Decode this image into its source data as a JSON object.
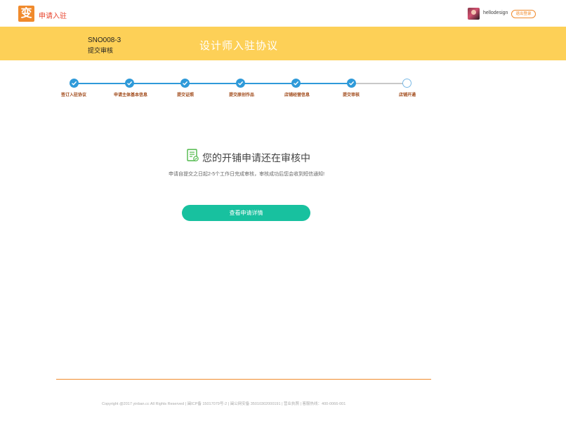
{
  "header": {
    "logo_char": "变",
    "brand": "申请入驻",
    "username": "hellodesign",
    "logout_label": "退出登录"
  },
  "banner": {
    "sno": "SNO008-3",
    "status": "提交审核",
    "title": "设计师入驻协议"
  },
  "steps": [
    {
      "label": "签订入驻协议",
      "done": true
    },
    {
      "label": "申请主体基本信息",
      "done": true
    },
    {
      "label": "提交证照",
      "done": true
    },
    {
      "label": "提交原创作品",
      "done": true
    },
    {
      "label": "店铺经营信息",
      "done": true
    },
    {
      "label": "提交审核",
      "done": true
    },
    {
      "label": "店铺开通",
      "done": false
    }
  ],
  "message": {
    "title": "您的开铺申请还在审核中",
    "subtitle": "申请自提交之日起2-5个工作日完成审核，审核成功后您会收到短信通知!"
  },
  "actions": {
    "detail_label": "查看申请详情"
  },
  "footer": {
    "text": "Copyright @2017 yinban.cc All Rights Reserved  |  闽ICP备 15017079号-2  |  闽公网安备 35010302000191  |  营业执照  |  客服热线：400-0066-001"
  },
  "colors": {
    "accent": "#f08a2c",
    "banner": "#fdd057",
    "step": "#2f9ad9",
    "button": "#18c19f"
  }
}
